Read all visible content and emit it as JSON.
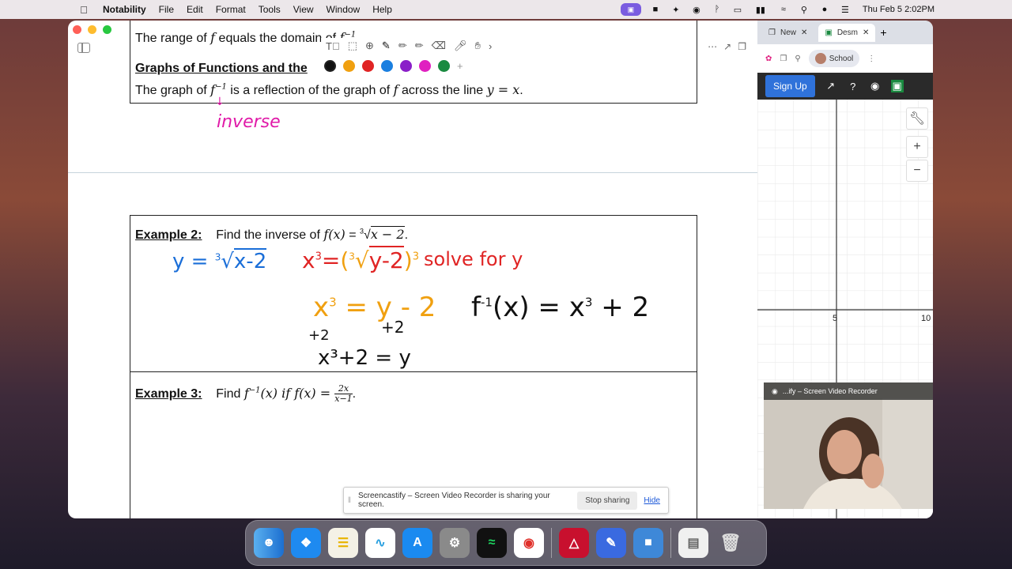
{
  "menubar": {
    "app_name": "Notability",
    "menus": [
      "File",
      "Edit",
      "Format",
      "Tools",
      "View",
      "Window",
      "Help"
    ],
    "clock": "Thu Feb 5  2:02PM"
  },
  "notability": {
    "box1": {
      "line1_pre": "The range of ",
      "line1_f": "f",
      "line1_post": " equals the domain of ",
      "line1_finv": "f",
      "line1_exp": "−1",
      "heading": "Graphs of Functions and the",
      "line3_pre": "The graph of ",
      "line3_f": "f",
      "line3_exp": "−1",
      "line3_mid": " is a reflection of the graph of ",
      "line3_f2": "f",
      "line3_post": " across the line ",
      "line3_eq": "y = x",
      "line3_end": ".",
      "handwritten_inverse": "inverse"
    },
    "example2": {
      "label": "Example 2:",
      "text": "Find the inverse of ",
      "fx": "f(x)",
      "eq": " = ",
      "root_index": "3",
      "radicand": "x − 2",
      "end": ".",
      "hw_blue": "y = ∛(x-2)",
      "hw_blue_idx": "3",
      "hw_blue_rad": "x-2",
      "hw_swap_x": "x",
      "hw_swap_exp": "3",
      "hw_swap_eq": "=",
      "hw_swap_idx": "3",
      "hw_swap_rad": "y-2",
      "hw_solve": "solve for y",
      "hw_step1_x": "x",
      "hw_step1_exp": "3",
      "hw_step1_rest": "= y - 2",
      "hw_plus2_left": "+2",
      "hw_plus2_right": "+2",
      "hw_step2": "x³+2 = y",
      "hw_answer_f": "f",
      "hw_answer_exp": "-1",
      "hw_answer_rest": "(x) = x",
      "hw_answer_exp2": "3",
      "hw_answer_end": "+ 2"
    },
    "example3": {
      "label": "Example 3:",
      "text": "Find ",
      "finv": "f",
      "finv_exp": "−1",
      "finv_arg": "(x) if ",
      "fx": "f(x) = ",
      "num": "2x",
      "den": "x−1",
      "end": "."
    },
    "palette": [
      "#111111",
      "#f0a010",
      "#e02424",
      "#1a7fe0",
      "#8a1fc8",
      "#e020c0",
      "#1a8a40"
    ]
  },
  "share_banner": {
    "message": "Screencastify – Screen Video Recorder is sharing your screen.",
    "stop_label": "Stop sharing",
    "hide_label": "Hide"
  },
  "browser": {
    "tabs": [
      "New",
      "Desm"
    ],
    "school_label": "School",
    "signup_label": "Sign Up",
    "axis_labels": [
      "5",
      "10"
    ]
  },
  "webcam": {
    "title": "...ify – Screen Video Recorder"
  }
}
